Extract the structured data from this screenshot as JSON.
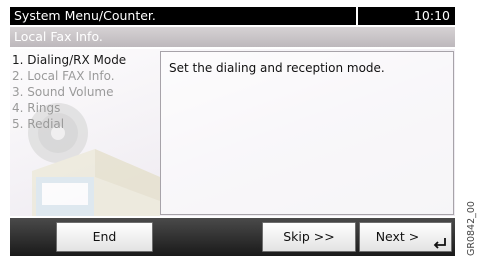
{
  "header": {
    "title": "System Menu/Counter.",
    "clock": "10:10"
  },
  "subheader": {
    "title": "Local Fax Info."
  },
  "menu": {
    "items": [
      {
        "label": "1. Dialing/RX Mode",
        "active": true
      },
      {
        "label": "2. Local FAX Info.",
        "active": false
      },
      {
        "label": "3. Sound Volume",
        "active": false
      },
      {
        "label": "4. Rings",
        "active": false
      },
      {
        "label": "5. Redial",
        "active": false
      }
    ]
  },
  "description": {
    "text": "Set the dialing and reception mode."
  },
  "buttons": {
    "end": "End",
    "skip": "Skip >>",
    "next": "Next >"
  },
  "icons": {
    "next_enter": "enter-return-icon"
  },
  "side_code": "GR0842_00",
  "colors": {
    "title_bar": "#000000",
    "sub_bar": "#c9c5c8",
    "bottom_bar": "#262626",
    "active_text": "#1a1a1a",
    "inactive_text": "#9a9a9a"
  }
}
